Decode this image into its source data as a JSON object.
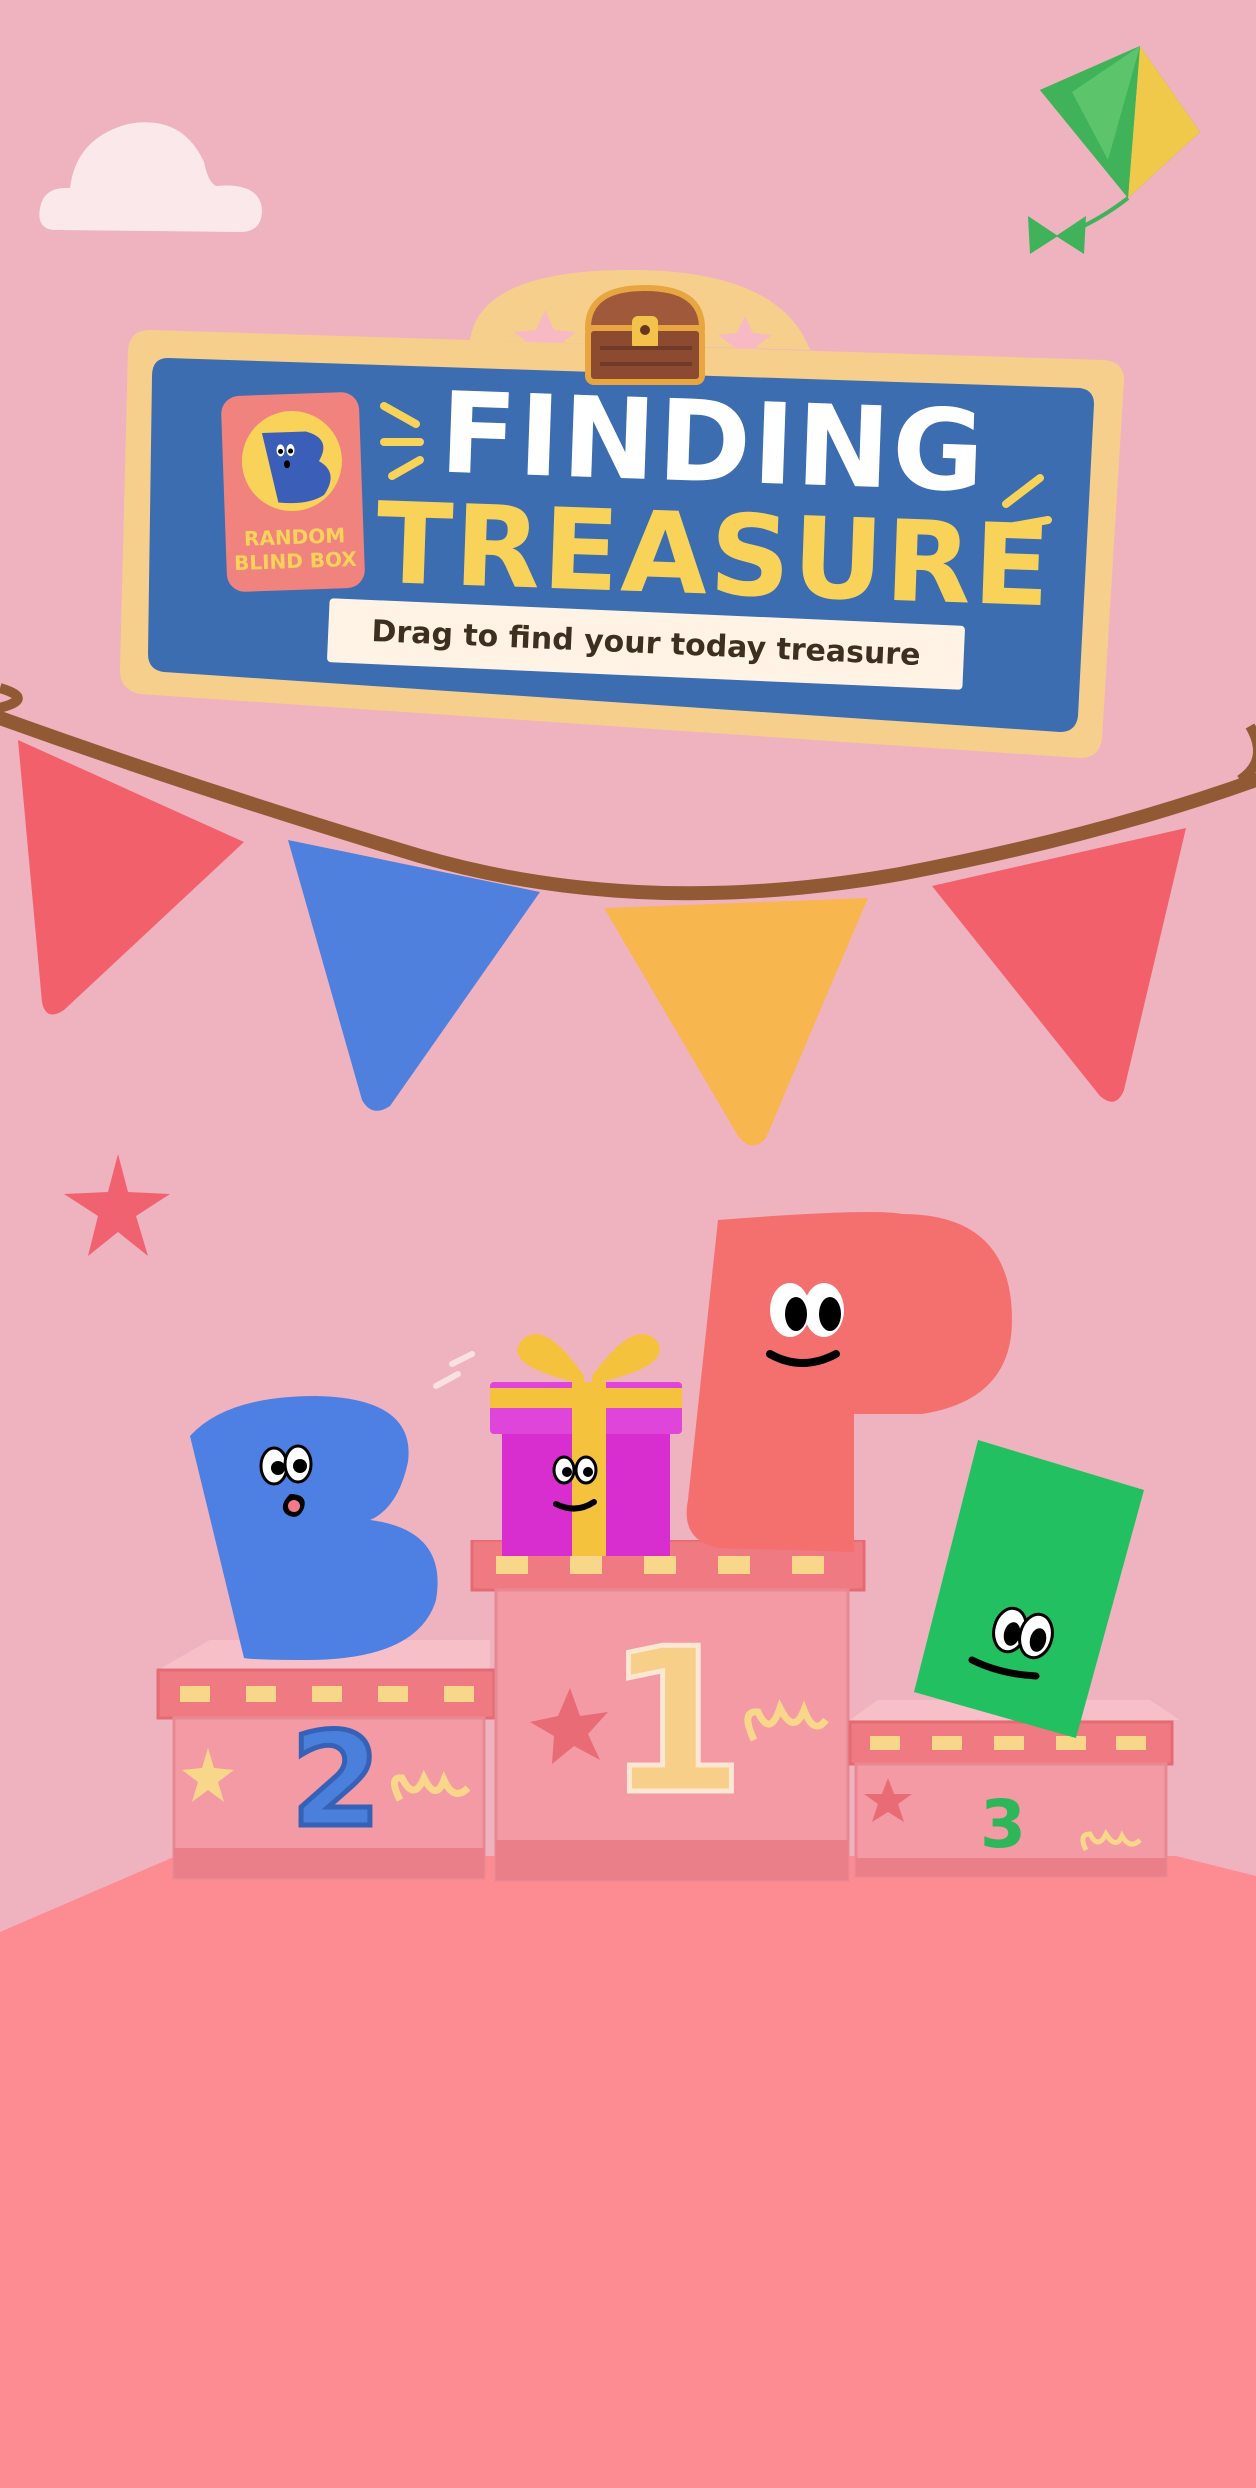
{
  "header": {
    "title_line1": "FINDING",
    "title_line2": "TREASURE",
    "subtitle": "Drag to find your today treasure"
  },
  "logo": {
    "letter": "B",
    "line1": "RANDOM",
    "line2": "BLIND BOX"
  },
  "podium": {
    "first": "1",
    "second": "2",
    "third": "3"
  },
  "icons": {
    "chest": "treasure-chest-icon",
    "kite": "kite-icon",
    "gift": "gift-box-icon",
    "cloud": "cloud-icon"
  },
  "colors": {
    "background": "#efb3bf",
    "banner_blue": "#3b6db0",
    "banner_frame": "#f6cf8d",
    "title_white": "#ffffff",
    "title_yellow": "#f9d25a",
    "flag_red": "#f2606b",
    "flag_blue": "#4f80dd",
    "flag_yellow": "#f7b74e",
    "floor": "#fd8c92",
    "character_blue": "#4d80e2",
    "character_red": "#f3706f",
    "character_green": "#22c060",
    "gift_magenta": "#dc34d6"
  }
}
